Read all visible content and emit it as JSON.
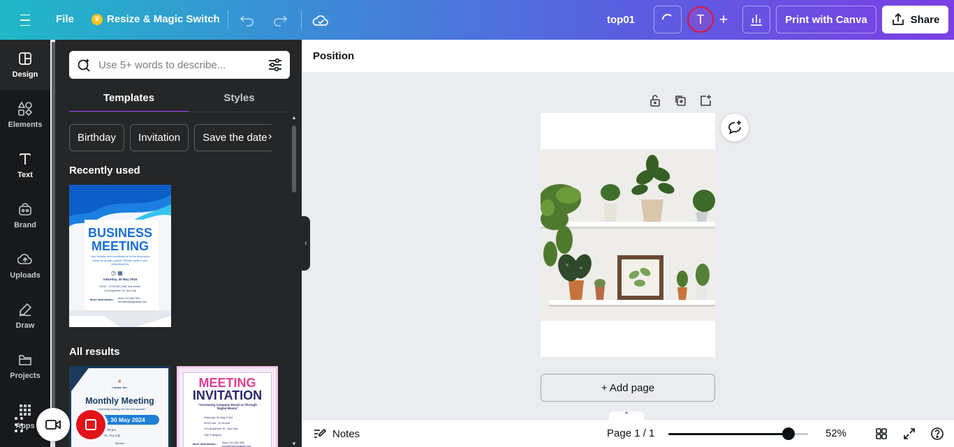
{
  "topbar": {
    "file_label": "File",
    "resize_label": "Resize & Magic Switch",
    "design_title": "top01",
    "avatar_initial": "T",
    "print_label": "Print with Canva",
    "share_label": "Share"
  },
  "rail": {
    "items": [
      {
        "label": "Design",
        "icon": "design-icon"
      },
      {
        "label": "Elements",
        "icon": "elements-icon"
      },
      {
        "label": "Text",
        "icon": "text-icon"
      },
      {
        "label": "Brand",
        "icon": "brand-icon"
      },
      {
        "label": "Uploads",
        "icon": "uploads-icon"
      },
      {
        "label": "Draw",
        "icon": "draw-icon"
      },
      {
        "label": "Projects",
        "icon": "projects-icon"
      },
      {
        "label": "Apps",
        "icon": "apps-icon"
      }
    ]
  },
  "panel": {
    "search_placeholder": "Use 5+ words to describe...",
    "tabs": [
      "Templates",
      "Styles"
    ],
    "chips": [
      "Birthday",
      "Invitation",
      "Save the date"
    ],
    "recently_used_title": "Recently used",
    "all_results_title": "All results",
    "templates": {
      "business": {
        "title_line1": "BUSINESS",
        "title_line2": "MEETING",
        "body": "Your insights and contributions to the discussion would be greatly valued. Please confirm your attendance by",
        "date": "Saturday, 30 May 2024",
        "time": "09:00 - 10:00 AM | Hall Tom-erman",
        "address": "123 Anywhere St., Any City",
        "more_label": "More Information :",
        "more_value": "Anna 123-456-7890 hello@reallygreatsite.com"
      },
      "monthly": {
        "company": "Larana, Inc.",
        "title": "Monthly Meeting",
        "subtitle": "\"...n planning strategy for the next quarter\"",
        "date": "...y, 30 May 2024",
        "time": "...0:00 am - 12:00 pm",
        "address": "...Anywhere St., Any City",
        "footer": "Speaker"
      },
      "meeting": {
        "title_line1": "MEETING",
        "title_line2": "INVITATION",
        "subtitle": "\"Increasing Company Reach at Through Digital Means\"",
        "date": "Saturday, 30 May 2024",
        "time": "09:00 AM - 11:00 AM",
        "address": "123 Anywhere St., Any City",
        "hall": "Hall: Passport",
        "more_label": "More Information :",
        "more_value": "Anna 123-456-7890 hello@reallygreatsite.com"
      }
    }
  },
  "canvas": {
    "context_label": "Position",
    "add_page_label": "+ Add page"
  },
  "bottombar": {
    "notes_label": "Notes",
    "pager_label": "Page 1 / 1",
    "zoom_label": "52%",
    "zoom_value": 52
  },
  "colors": {
    "accent": "#8b3dff",
    "record": "#e3131c",
    "avatar": "#7a52d6"
  }
}
